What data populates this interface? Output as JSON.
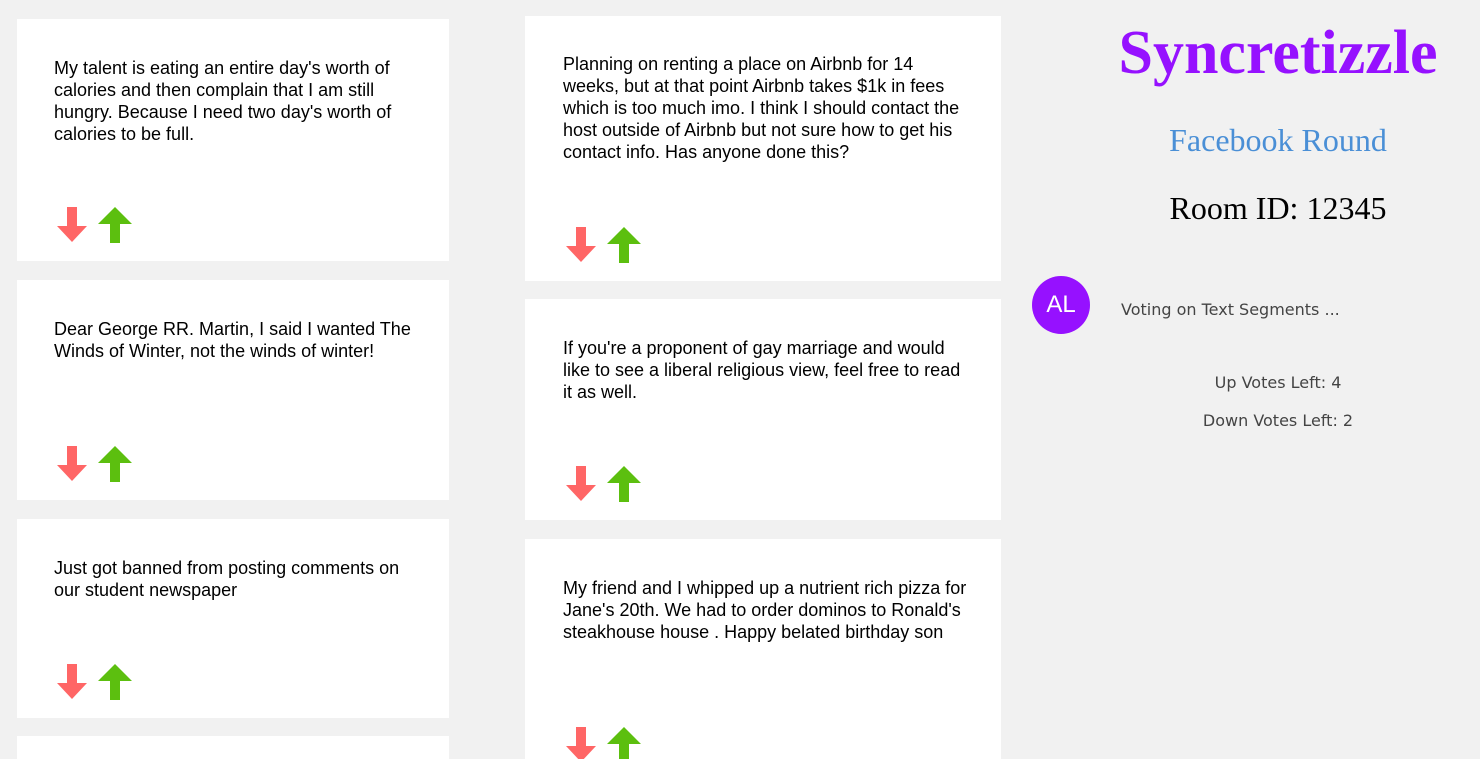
{
  "sidebar": {
    "title": "Syncretizzle",
    "round": "Facebook Round",
    "room_id": "Room ID: 12345",
    "avatar_initials": "AL",
    "status": "Voting on Text Segments ...",
    "up_votes_left": "Up Votes Left: 4",
    "down_votes_left": "Down Votes Left: 2",
    "colors": {
      "title": "#9611ff",
      "round": "#4a8fd6",
      "avatar": "#9611ff"
    }
  },
  "vote_icons": {
    "down": {
      "icon": "down-arrow-icon",
      "color": "#ff6666"
    },
    "up": {
      "icon": "up-arrow-icon",
      "color": "#5cbf0f"
    }
  },
  "segments": [
    {
      "text": "My talent is eating an entire day's worth of calories and then complain that I am still hungry. Because I need two day's worth of calories to be full."
    },
    {
      "text": "Dear George RR. Martin, I said I wanted The Winds of Winter, not the winds of winter!"
    },
    {
      "text": "Just got banned from posting comments on our student newspaper"
    },
    {
      "text": "Planning on renting a place on Airbnb for 14 weeks, but at that point Airbnb takes $1k in fees which is too much imo. I think I should contact the host outside of Airbnb but not sure how to get his contact info. Has anyone done this?"
    },
    {
      "text": "If you're a proponent of gay marriage and would like to see a liberal religious view, feel free to read it as well."
    },
    {
      "text": "My friend and I whipped up a nutrient rich pizza for Jane's 20th. We had to order dominos to Ronald's steakhouse house . Happy belated birthday son"
    }
  ]
}
